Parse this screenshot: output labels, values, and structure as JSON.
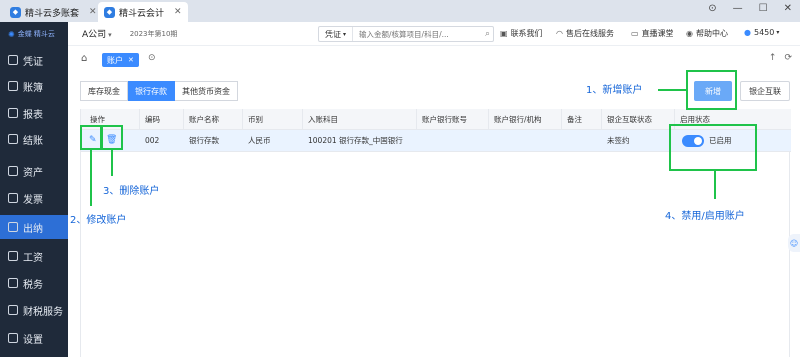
{
  "tabs": [
    {
      "icon": "app-icon",
      "label": "精斗云多账套"
    },
    {
      "icon": "app-icon",
      "label": "精斗云会计"
    }
  ],
  "window_controls": [
    "⊙",
    "—",
    "☐",
    "✕"
  ],
  "sidebar": {
    "logo": "金蝶 精斗云",
    "items": [
      {
        "label": "凭证",
        "icon": "voucher-icon"
      },
      {
        "label": "账簿",
        "icon": "ledger-icon"
      },
      {
        "label": "报表",
        "icon": "report-icon"
      },
      {
        "label": "结账",
        "icon": "close-books-icon"
      },
      {
        "label": "资产",
        "icon": "asset-icon"
      },
      {
        "label": "发票",
        "icon": "invoice-icon"
      },
      {
        "label": "出纳",
        "icon": "cashier-icon",
        "active": true
      },
      {
        "label": "工资",
        "icon": "salary-icon"
      },
      {
        "label": "税务",
        "icon": "tax-icon"
      },
      {
        "label": "财税服务",
        "icon": "service-icon"
      },
      {
        "label": "设置",
        "icon": "settings-icon"
      }
    ]
  },
  "header": {
    "company": "A公司",
    "period": "2023年第10期",
    "search_type": "凭证",
    "search_placeholder": "输入金额/核算项目/科目/...",
    "links": [
      "联系我们",
      "售后在线服务",
      "直播课堂",
      "帮助中心"
    ],
    "user_count": "5450"
  },
  "page_tab": "账户",
  "segments": [
    "库存现金",
    "银行存款",
    "其他货币资金"
  ],
  "active_segment": "银行存款",
  "buttons": {
    "new": "新增",
    "bank": "银企互联"
  },
  "table": {
    "columns": [
      "操作",
      "编码",
      "账户名称",
      "币别",
      "入账科目",
      "账户银行账号",
      "账户银行/机构",
      "备注",
      "银企互联状态",
      "启用状态"
    ],
    "rows": [
      {
        "code": "002",
        "name": "银行存款",
        "currency": "人民币",
        "subject": "100201 银行存款_中国银行",
        "account_no": "",
        "bank": "",
        "remark": "",
        "bank_status": "未签约",
        "enabled": "已启用"
      }
    ]
  },
  "annotations": [
    "1、新增账户",
    "2、修改账户",
    "3、删除账户",
    "4、禁用/启用账户"
  ],
  "accent_color": "#3b8bff",
  "annotation_color": "#1fc34a"
}
